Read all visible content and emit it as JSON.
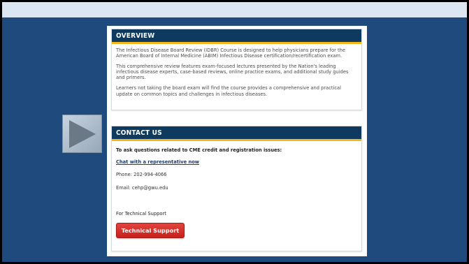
{
  "overview": {
    "title": "OVERVIEW",
    "paragraphs": [
      "The Infectious Disease Board Review (IDBR) Course is designed to help physicians prepare for the American Board of Internal Medicine (ABIM) Infectious Disease certification/recertification exam.",
      "This comprehensive review features exam-focused lectures presented by the Nation's leading infectious disease experts, case-based reviews, online practice exams, and additional study guides and primers.",
      "Learners not taking the board exam will find the course provides a comprehensive and practical update on common topics and challenges in infectious diseases."
    ]
  },
  "contact": {
    "title": "CONTACT US",
    "intro": "To ask questions related to CME credit and registration issues:",
    "chat_link": "Chat with a representative now",
    "phone": "Phone: 202-994-4066",
    "email": "Email: cehp@gwu.edu",
    "tech_label": "For Technical Support",
    "tech_button": "Technical Support"
  },
  "icons": {
    "play": "play-icon"
  },
  "colors": {
    "background": "#1e4a7d",
    "header": "#0d3a5e",
    "accent": "#f2b51c",
    "button": "#c8201b"
  }
}
